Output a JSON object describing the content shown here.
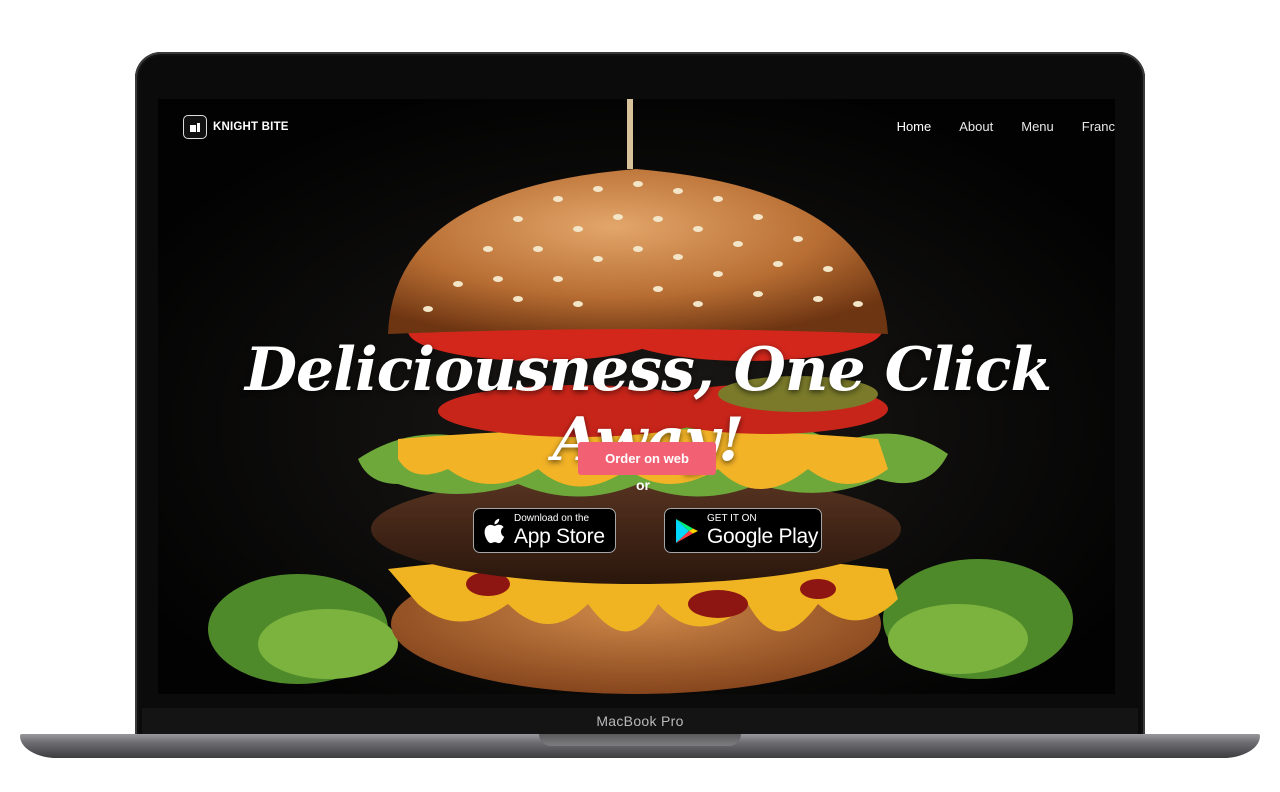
{
  "device": {
    "label": "MacBook Pro"
  },
  "site": {
    "brand": "KNIGHT BITE",
    "nav": [
      {
        "label": "Home",
        "active": true
      },
      {
        "label": "About"
      },
      {
        "label": "Menu"
      },
      {
        "label": "Franc"
      }
    ],
    "headline": "Deliciousness, One Click Away!",
    "order_button": "Order on web",
    "or_text": "or",
    "app_store": {
      "small": "Download on the",
      "big": "App Store"
    },
    "google_play": {
      "small": "GET IT ON",
      "big": "Google Play"
    }
  },
  "colors": {
    "accent": "#f26173",
    "background": "#050505",
    "text": "#ffffff"
  }
}
